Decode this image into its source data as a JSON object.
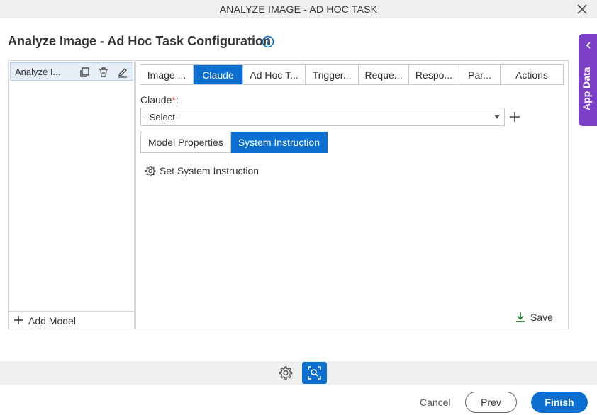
{
  "window": {
    "title": "ANALYZE IMAGE - AD HOC TASK"
  },
  "page": {
    "title": "Analyze Image - Ad Hoc Task Configuration"
  },
  "models": {
    "items": [
      {
        "label": "Analyze I..."
      }
    ],
    "add_label": "Add Model"
  },
  "tabs": [
    {
      "label": "Image ...",
      "active": false
    },
    {
      "label": "Claude",
      "active": true
    },
    {
      "label": "Ad Hoc T...",
      "active": false
    },
    {
      "label": "Trigger...",
      "active": false
    },
    {
      "label": "Reque...",
      "active": false
    },
    {
      "label": "Respo...",
      "active": false
    },
    {
      "label": "Par...",
      "active": false
    },
    {
      "label": "Actions",
      "active": false
    }
  ],
  "claude_field": {
    "label": "Claude",
    "required_mark": "*",
    "colon": ":",
    "value": "--Select--"
  },
  "subtabs": [
    {
      "label": "Model Properties",
      "active": false
    },
    {
      "label": "System Instruction",
      "active": true
    }
  ],
  "system_instruction": {
    "link_label": "Set System Instruction"
  },
  "save_label": "Save",
  "app_data": {
    "label": "App Data"
  },
  "footer": {
    "cancel": "Cancel",
    "prev": "Prev",
    "finish": "Finish"
  },
  "colors": {
    "accent": "#0a6fd0",
    "app_data_bg": "#7b3fc8",
    "save_icon": "#2e7d32"
  },
  "icons": [
    "close-icon",
    "info-icon",
    "copy-icon",
    "delete-icon",
    "edit-icon",
    "plus-icon",
    "gear-icon",
    "download-icon",
    "chevron-left-icon",
    "preview-icon"
  ]
}
